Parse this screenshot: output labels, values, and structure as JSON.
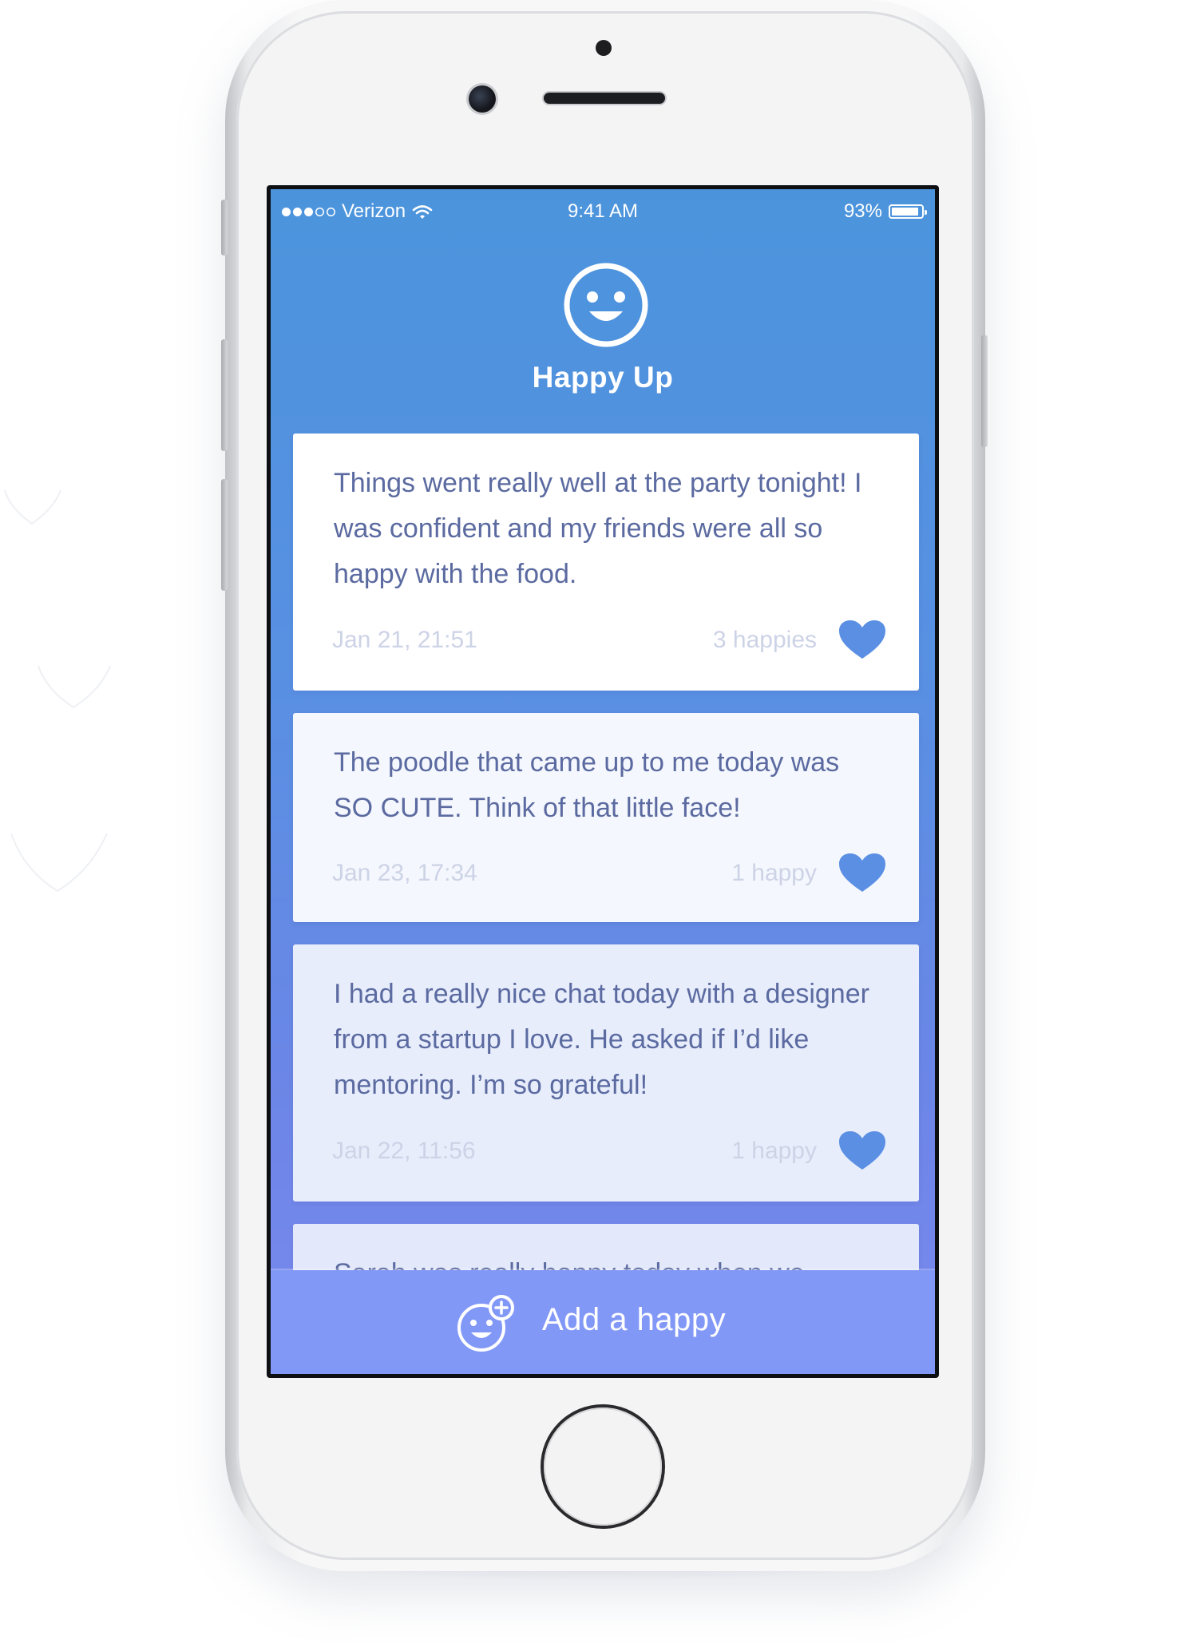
{
  "status_bar": {
    "carrier": "Verizon",
    "time": "9:41 AM",
    "battery": "93%",
    "battery_level": 0.93,
    "signal_bars_filled": 3,
    "signal_bars_total": 5
  },
  "app": {
    "title": "Happy Up",
    "logo_icon": "smiley-face-icon"
  },
  "feed": {
    "items": [
      {
        "text": "Things went really well at the party tonight! I was confident and my friends were all so happy with the food.",
        "date": "Jan 21, 21:51",
        "count": "3 happies",
        "icon": "heart-icon"
      },
      {
        "text": "The poodle that came up to me today was SO CUTE. Think of that little face!",
        "date": "Jan 23, 17:34",
        "count": "1 happy",
        "icon": "heart-icon"
      },
      {
        "text": "I had a really nice chat today with a designer from a startup I love. He asked if I’d like mentoring. I’m so grateful!",
        "date": "Jan 22, 11:56",
        "count": "1 happy",
        "icon": "heart-icon"
      },
      {
        "text": "Sarah was really happy today when we"
      }
    ]
  },
  "add_bar": {
    "label": "Add a happy",
    "icon": "add-smiley-icon"
  },
  "colors": {
    "gradient_top": "#4b94dc",
    "gradient_bottom": "#7a88ee",
    "add_bar": "#8298f7",
    "card_text": "#5b6aa0",
    "heart": "#5b8fe4",
    "meta_text": "#cdd3e6"
  }
}
